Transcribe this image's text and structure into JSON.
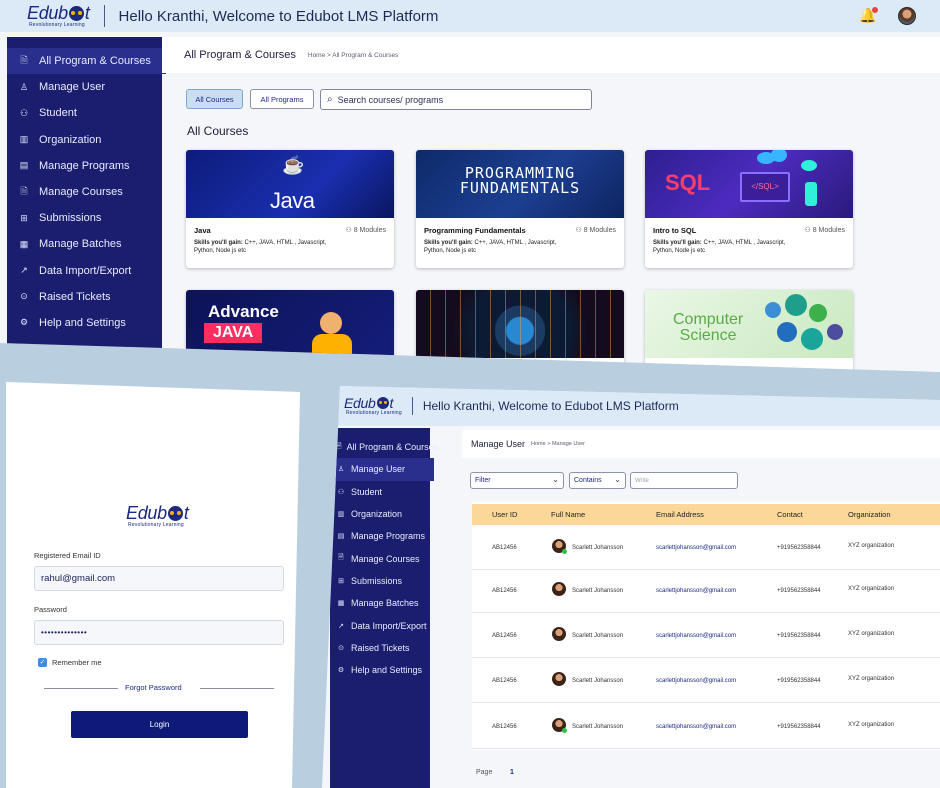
{
  "brand": {
    "name_left": "Edub",
    "name_right": "t",
    "tagline": "Revolutionary Learning"
  },
  "header": {
    "welcome": "Hello Kranthi, Welcome to Edubot LMS Platform"
  },
  "icons": {
    "bell": "bell-icon",
    "avatar": "user-avatar",
    "search": "search-icon",
    "checkbox": "check-icon"
  },
  "colors": {
    "sidebar": "#1b1e6e",
    "header": "#dceaf7",
    "accent": "#0e1a78",
    "table_header": "#fcd79a"
  },
  "sidebar": {
    "items": [
      {
        "label": "All Program & Courses",
        "icon": "document-icon",
        "glyph": "🗎"
      },
      {
        "label": "Manage User",
        "icon": "user-icon",
        "glyph": "♙"
      },
      {
        "label": "Student",
        "icon": "students-icon",
        "glyph": "⚇"
      },
      {
        "label": "Organization",
        "icon": "building-icon",
        "glyph": "▥"
      },
      {
        "label": "Manage Programs",
        "icon": "program-icon",
        "glyph": "▤"
      },
      {
        "label": "Manage Courses",
        "icon": "course-icon",
        "glyph": "🗎"
      },
      {
        "label": "Submissions",
        "icon": "submission-icon",
        "glyph": "⊞"
      },
      {
        "label": "Manage Batches",
        "icon": "batch-icon",
        "glyph": "▦"
      },
      {
        "label": "Data Import/Export",
        "icon": "chart-line-icon",
        "glyph": "↗"
      },
      {
        "label": "Raised Tickets",
        "icon": "ticket-icon",
        "glyph": "⊙"
      },
      {
        "label": "Help and Settings",
        "icon": "gear-icon",
        "glyph": "⚙"
      }
    ]
  },
  "courses_page": {
    "title": "All Program & Courses",
    "breadcrumb": "Home > All Program & Courses",
    "filters": {
      "all_courses": "All Courses",
      "all_programs": "All Programs"
    },
    "search_placeholder": "Search courses/ programs",
    "section_title": "All Courses",
    "cards": [
      {
        "name": "Java",
        "modules": "8 Modules",
        "skills_label": "Skills you'll gain:",
        "skills": "C++, JAVA, HTML , Javascript, Python, Node js etc",
        "thumb_text": "Java"
      },
      {
        "name": "Programming Fundamentals",
        "modules": "8 Modules",
        "skills_label": "Skills you'll gain:",
        "skills": "C++, JAVA, HTML , Javascript, Python, Node js etc",
        "thumb_text": "PROGRAMMING FUNDAMENTALS"
      },
      {
        "name": "Intro to SQL",
        "modules": "8 Modules",
        "skills_label": "Skills you'll gain:",
        "skills": "C++, JAVA, HTML , Javascript, Python, Node js etc",
        "thumb_text": "SQL",
        "thumb_sub": "</SQL>"
      }
    ],
    "cards_row2": [
      {
        "thumb_line1": "Advance",
        "thumb_line2": "JAVA"
      },
      {
        "thumb_text": ""
      },
      {
        "thumb_line1": "Computer",
        "thumb_line2": "Science"
      }
    ]
  },
  "login": {
    "email_label": "Registered Email ID",
    "email_value": "rahul@gmail.com",
    "password_label": "Password",
    "password_value": "••••••••••••••",
    "remember": "Remember me",
    "forgot": "Forgot Password",
    "login_button": "Login"
  },
  "manage_user": {
    "title": "Manage User",
    "breadcrumb": "Home > Manage User",
    "filter": "Filter",
    "contains": "Contains",
    "write_placeholder": "Write",
    "columns": [
      "User ID",
      "Full Name",
      "Email Address",
      "Contact",
      "Organization"
    ],
    "rows": [
      {
        "id": "AB12456",
        "name": "Scarlett Johansson",
        "email": "scarlettjohansson@gmail.com",
        "contact": "+919562358844",
        "org": "XYZ organization"
      },
      {
        "id": "AB12456",
        "name": "Scarlett Johansson",
        "email": "scarlettjohansson@gmail.com",
        "contact": "+919562358844",
        "org": "XYZ organization"
      },
      {
        "id": "AB12456",
        "name": "Scarlett Johansson",
        "email": "scarlettjohansson@gmail.com",
        "contact": "+919562358844",
        "org": "XYZ organization"
      },
      {
        "id": "AB12456",
        "name": "Scarlett Johansson",
        "email": "scarlettjohansson@gmail.com",
        "contact": "+919562358844",
        "org": "XYZ organization"
      },
      {
        "id": "AB12456",
        "name": "Scarlett Johansson",
        "email": "scarlettjohansson@gmail.com",
        "contact": "+919562358844",
        "org": "XYZ organization"
      }
    ],
    "page_label": "Page",
    "page_number": "1"
  }
}
